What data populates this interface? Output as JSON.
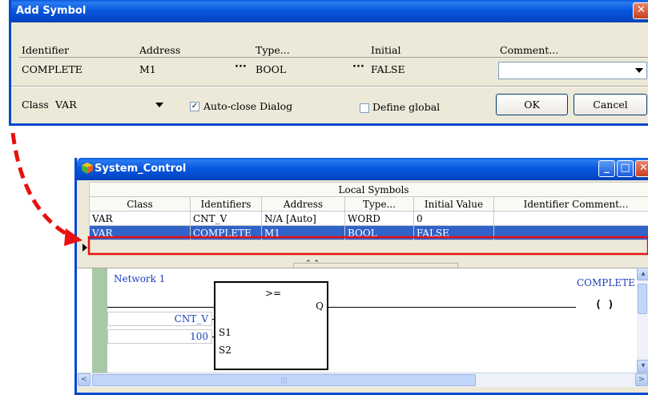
{
  "add_symbol": {
    "title": "Add Symbol",
    "close_glyph": "✕",
    "headers": {
      "identifier": "Identifier",
      "address": "Address",
      "type": "Type...",
      "initial": "Initial",
      "comment": "Comment..."
    },
    "values": {
      "identifier": "COMPLETE",
      "address": "M1",
      "type": "BOOL",
      "initial": "FALSE",
      "comment": ""
    },
    "ellipsis": "···",
    "class_label": "Class",
    "class_value": "VAR",
    "auto_close_label": "Auto-close Dialog",
    "auto_close_checked": "✓",
    "define_global_label": "Define global",
    "ok_label": "OK",
    "cancel_label": "Cancel"
  },
  "system_control": {
    "title": "System_Control",
    "section_title": "Local Symbols",
    "columns": [
      "Class",
      "Identifiers",
      "Address",
      "Type...",
      "Initial Value",
      "Identifier Comment..."
    ],
    "rows": [
      [
        "VAR",
        "CNT_V",
        "N/A [Auto]",
        "WORD",
        "0",
        ""
      ],
      [
        "VAR",
        "COMPLETE",
        "M1",
        "BOOL",
        "FALSE",
        ""
      ]
    ],
    "network_label": "Network 1",
    "block_op": ">=",
    "block_out": "Q",
    "block_in1": "S1",
    "block_in2": "S2",
    "input1": "CNT_V",
    "input2": "100",
    "coil_name": "COMPLETE",
    "coil_symbol": "(  )",
    "btn_min": "_",
    "btn_max": "□",
    "btn_close": "✕",
    "splitter_glyphs": "⌃ ⌃",
    "scroll_glyphs": {
      "left": "<",
      "right": ">",
      "up": "▴",
      "down": "▾",
      "thumb": "|||"
    }
  },
  "colors": {
    "xp_blue": "#0548d0",
    "selection": "#3163c9",
    "highlight": "#e81010",
    "annotation_arrow": "#e81010",
    "ladder_text": "#1c3fbc"
  }
}
